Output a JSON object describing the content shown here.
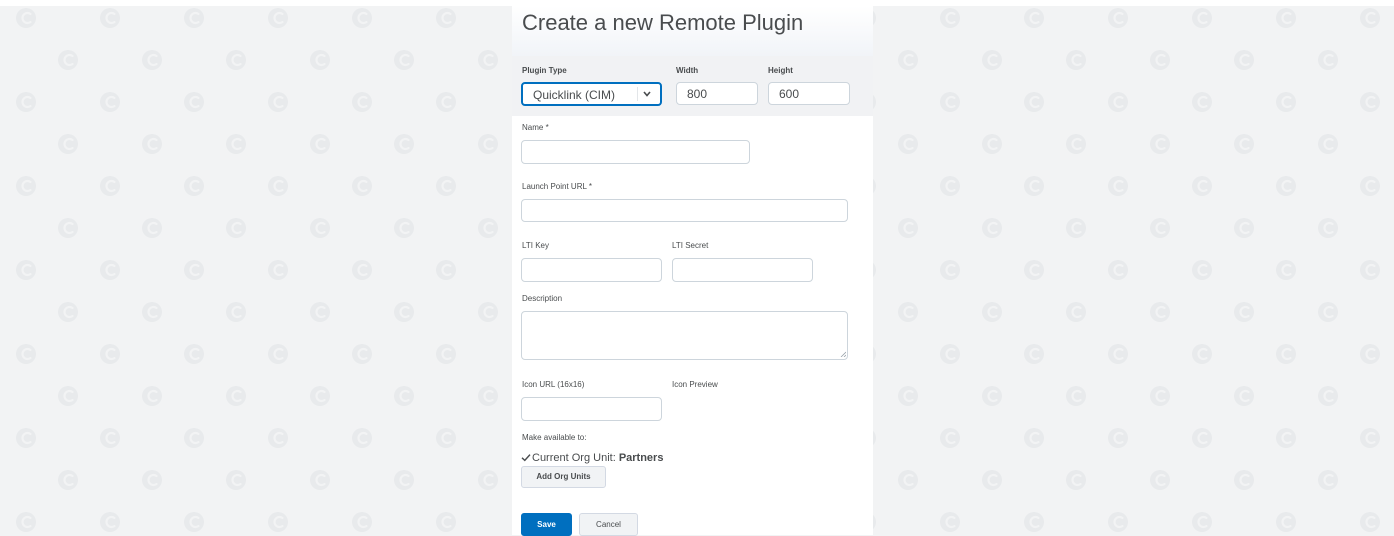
{
  "page": {
    "title": "Create a new Remote Plugin"
  },
  "plugin_type": {
    "label": "Plugin Type",
    "selected": "Quicklink (CIM)"
  },
  "width": {
    "label": "Width",
    "value": "800"
  },
  "height": {
    "label": "Height",
    "value": "600"
  },
  "name": {
    "label": "Name *",
    "value": ""
  },
  "launch_url": {
    "label": "Launch Point URL *",
    "value": ""
  },
  "lti_key": {
    "label": "LTI Key",
    "value": ""
  },
  "lti_secret": {
    "label": "LTI Secret",
    "value": ""
  },
  "description": {
    "label": "Description",
    "value": ""
  },
  "icon_url": {
    "label": "Icon URL (16x16)",
    "value": ""
  },
  "icon_preview": {
    "label": "Icon Preview"
  },
  "availability": {
    "label": "Make available to:",
    "checkbox_prefix": "Current Org Unit:",
    "org_unit": "Partners",
    "checked": true,
    "add_button": "Add Org Units"
  },
  "actions": {
    "save": "Save",
    "cancel": "Cancel"
  },
  "colors": {
    "primary": "#006fbf",
    "background_pattern_icon": "#e8eaec"
  },
  "icons": {
    "background": "logo-pattern-icon",
    "dropdown": "chevron-down-icon",
    "check": "checkmark-icon",
    "resize": "resize-grip-icon"
  }
}
